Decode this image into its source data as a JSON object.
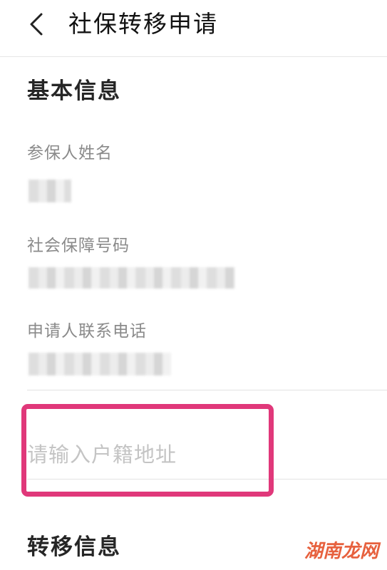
{
  "header": {
    "title": "社保转移申请"
  },
  "basic_info": {
    "section_title": "基本信息",
    "fields": [
      {
        "label": "参保人姓名"
      },
      {
        "label": "社会保障号码"
      },
      {
        "label": "申请人联系电话"
      }
    ],
    "address": {
      "value": "",
      "placeholder": "请输入户籍地址"
    }
  },
  "transfer_info": {
    "section_title": "转移信息"
  },
  "watermark": {
    "text": "湖南龙网"
  },
  "colors": {
    "highlight": "#e0387a",
    "placeholder": "#c4c4c4",
    "label": "#8a8a8a",
    "watermark": "#e5502a"
  },
  "icons": {
    "back": "chevron-left-icon"
  }
}
